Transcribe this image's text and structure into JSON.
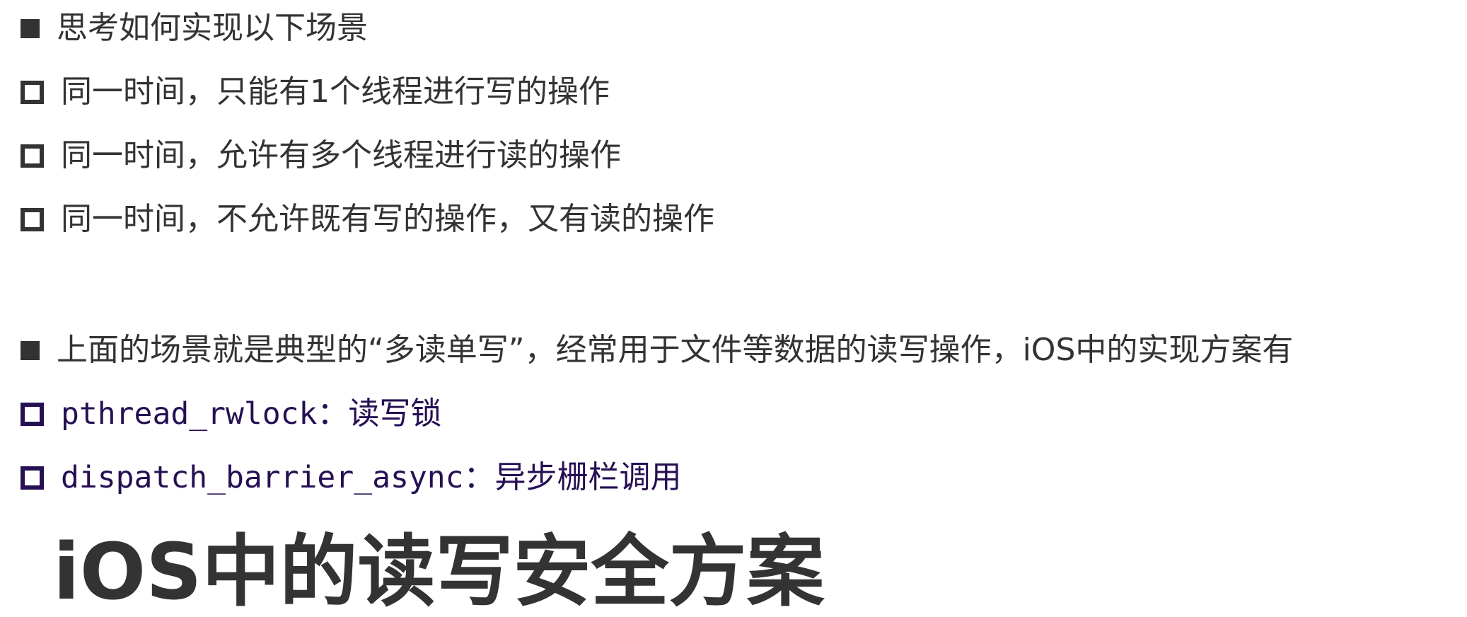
{
  "scenario": {
    "heading": "思考如何实现以下场景",
    "items": [
      "同一时间，只能有1个线程进行写的操作",
      "同一时间，允许有多个线程进行读的操作",
      "同一时间，不允许既有写的操作，又有读的操作"
    ]
  },
  "solution": {
    "heading": "上面的场景就是典型的“多读单写”，经常用于文件等数据的读写操作，iOS中的实现方案有",
    "items": [
      {
        "code": "pthread_rwlock",
        "desc": "：读写锁"
      },
      {
        "code": "dispatch_barrier_async",
        "desc": "：异步栅栏调用"
      }
    ]
  },
  "title": "iOS中的读写安全方案",
  "colors": {
    "text": "#333333",
    "code": "#260f53",
    "background": "#ffffff"
  }
}
